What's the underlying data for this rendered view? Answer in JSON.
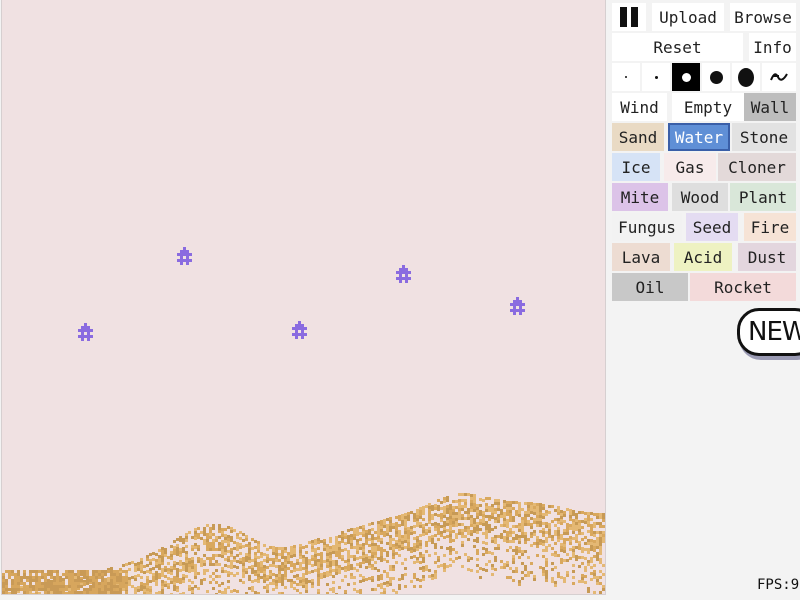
{
  "canvas": {
    "background": "#f0e1e2",
    "sand_color": "#d9a85e",
    "mite_color": "#8a6be0",
    "mites": [
      {
        "col": 182,
        "row": 256
      },
      {
        "col": 401,
        "row": 274
      },
      {
        "col": 515,
        "row": 306
      },
      {
        "col": 83,
        "row": 332
      },
      {
        "col": 297,
        "row": 330
      }
    ]
  },
  "toolbar": {
    "pause_icon": "pause-icon",
    "upload_label": "Upload",
    "browse_label": "Browse",
    "reset_label": "Reset",
    "info_label": "Info",
    "brush_sizes": [
      {
        "name": "size-1",
        "selected": false
      },
      {
        "name": "size-2",
        "selected": false
      },
      {
        "name": "size-3",
        "selected": true
      },
      {
        "name": "size-4",
        "selected": false
      },
      {
        "name": "size-5",
        "selected": false
      }
    ],
    "brush_extra_icon": "squiggle-icon"
  },
  "elements": [
    {
      "label": "Wind",
      "color": "#ffffff",
      "selected": false
    },
    {
      "label": "Empty",
      "color": "#ffffff",
      "selected": false
    },
    {
      "label": "Wall",
      "color": "#bdbdbd",
      "selected": false
    },
    {
      "label": "Sand",
      "color": "#e9dac4",
      "selected": false
    },
    {
      "label": "Water",
      "color": "#5f8fd6",
      "selected": true
    },
    {
      "label": "Stone",
      "color": "#e2e2e2",
      "selected": false
    },
    {
      "label": "Ice",
      "color": "#d6e3f6",
      "selected": false
    },
    {
      "label": "Gas",
      "color": "#f7ebeb",
      "selected": false
    },
    {
      "label": "Cloner",
      "color": "#e3d9d9",
      "selected": false
    },
    {
      "label": "Mite",
      "color": "#dcc3e8",
      "selected": false
    },
    {
      "label": "Wood",
      "color": "#dedede",
      "selected": false
    },
    {
      "label": "Plant",
      "color": "#d9e7d9",
      "selected": false
    },
    {
      "label": "Fungus",
      "color": "#f2f2f2",
      "selected": false
    },
    {
      "label": "Seed",
      "color": "#e4dcf2",
      "selected": false
    },
    {
      "label": "Fire",
      "color": "#f6e3d6",
      "selected": false
    },
    {
      "label": "Lava",
      "color": "#eddcd2",
      "selected": false
    },
    {
      "label": "Acid",
      "color": "#eef2c2",
      "selected": false
    },
    {
      "label": "Dust",
      "color": "#e3d6de",
      "selected": false
    },
    {
      "label": "Oil",
      "color": "#c8c8c8",
      "selected": false
    },
    {
      "label": "Rocket",
      "color": "#f3dada",
      "selected": false
    }
  ],
  "new_badge": "NEW",
  "fps_label": "FPS:9"
}
